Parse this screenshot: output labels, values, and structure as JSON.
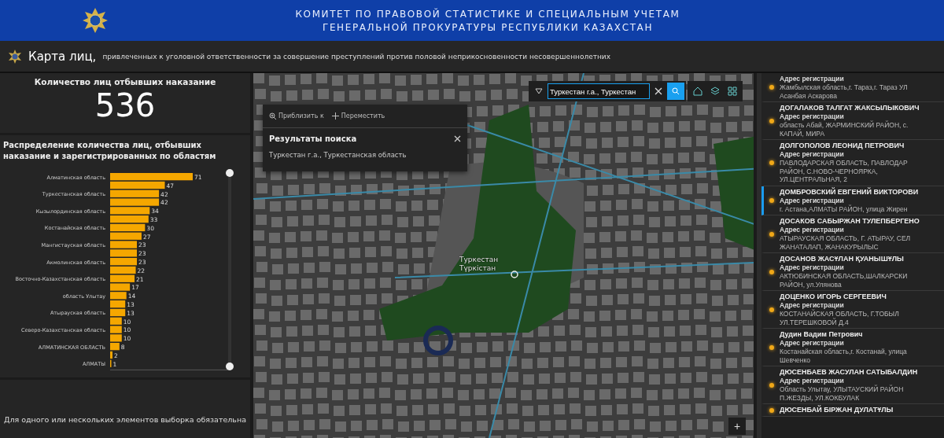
{
  "header": {
    "title_lines": [
      "КОМИТЕТ ПО ПРАВОВОЙ СТАТИСТИКЕ И СПЕЦИАЛЬНЫМ УЧЕТАМ",
      "ГЕНЕРАЛЬНОЙ ПРОКУРАТУРЫ РЕСПУБЛИКИ КАЗАХСТАН"
    ]
  },
  "subtitle": {
    "title": "Карта лиц,",
    "description": "привлеченных к уголовной ответственности за совершение преступлений против половой неприкосновенности несовершеннолетних"
  },
  "kpi": {
    "label": "Количество лиц отбывших наказание",
    "value": "536"
  },
  "chart_panel": {
    "title": "Распределение количества лиц, отбывших наказание и зарегистрированных по областям",
    "chart_data": {
      "type": "bar",
      "orientation": "horizontal",
      "data_labels": true,
      "categories": [
        "Алматинская область",
        null,
        "Туркестанская область",
        null,
        "Кызылординская область",
        null,
        "Костанайская область",
        null,
        "Мангистауская область",
        null,
        "Акмолинская область",
        null,
        "Восточно-Казахстанская область",
        null,
        "область Улытау",
        null,
        "Атырауская область",
        null,
        "Северо-Казахстанская область",
        null,
        "АЛМАТИНСКАЯ ОБЛАСТЬ",
        null,
        "АЛМАТЫ"
      ],
      "series": [
        {
          "color": "#f5a700",
          "values": [
            71,
            47,
            42,
            42,
            34,
            33,
            30,
            27,
            23,
            23,
            23,
            22,
            21,
            17,
            14,
            13,
            13,
            10,
            10,
            10,
            8,
            2,
            1
          ]
        }
      ]
    }
  },
  "notice": {
    "text": "Для одного или нескольких элементов выборка обязательна"
  },
  "map": {
    "search_value": "Туркестан г.а., Туркестан",
    "popup": {
      "actions": [
        "Приблизить к",
        "Переместить"
      ],
      "title": "Результаты поиска",
      "result": "Туркестан г.а., Туркестанская область"
    },
    "labels": [
      "Туркестан",
      "Түркістан"
    ],
    "zoom_in": "+"
  },
  "people": [
    {
      "address_label": "Адрес регистрации",
      "address_lines": [
        "Жамбылская область,г. Тараз,г. Тараз УЛ",
        "Асанбая Аскарова"
      ],
      "selected": false
    },
    {
      "name": "ДОГАЛАКОВ ТАЛГАТ ЖАКСЫЛЫКОВИЧ",
      "address_label": "Адрес регистрации",
      "address_lines": [
        "область Абай, ЖАРМИНСКИЙ РАЙОН, с.",
        "КАПАЙ, МИРА"
      ],
      "selected": false
    },
    {
      "name": "ДОЛГОПОЛОВ ЛЕОНИД ПЕТРОВИЧ",
      "address_label": "Адрес регистрации",
      "address_lines": [
        "ПАВЛОДАРСКАЯ ОБЛАСТЬ, ПАВЛОДАР",
        "РАЙОН, С.НОВО-ЧЕРНОЯРКА,",
        "УЛ.ЦЕНТРАЛЬНАЯ, 2"
      ],
      "selected": false
    },
    {
      "name": "ДОМБРОВСКИЙ ЕВГЕНИЙ ВИКТОРОВИ",
      "address_label": "Адрес регистрации",
      "address_lines": [
        "г. Астана,АЛМАТЫ РАЙОН, улица Жирен"
      ],
      "selected": true
    },
    {
      "name": "ДОСАКОВ САБЫРЖАН ТУЛЕПБЕРГЕНО",
      "address_label": "Адрес регистрации",
      "address_lines": [
        "АТЫРАУСКАЯ ОБЛАСТЬ, Г. АТЫРАУ, СЕЛ",
        "ЖАНАТАЛАП, ЖАНАКУРЫЛЫС"
      ],
      "selected": false
    },
    {
      "name": "ДОСАНОВ ЖАСҰЛАН ҚУАНЫШҰЛЫ",
      "address_label": "Адрес регистрации",
      "address_lines": [
        "АКТЮБИНСКАЯ ОБЛАСТЬ,ШАЛКАРСКИ",
        "РАЙОН, ул.Улянова"
      ],
      "selected": false
    },
    {
      "name": "ДОЦЕНКО ИГОРЬ СЕРГЕЕВИЧ",
      "address_label": "Адрес регистрации",
      "address_lines": [
        "КОСТАНАЙСКАЯ ОБЛАСТЬ, Г.ТОБЫЛ",
        "УЛ.ТЕРЕШКОВОЙ Д.4"
      ],
      "selected": false
    },
    {
      "name": "Дудин Вадим Петрович",
      "address_label": "Адрес регистрации",
      "address_lines": [
        "Костанайская область,г. Костанай, улица",
        "Шевченко"
      ],
      "selected": false
    },
    {
      "name": "ДЮСЕНБАЕВ ЖАСУЛАН САТЫБАЛДИН",
      "address_label": "Адрес регистрации",
      "address_lines": [
        "Область Улытау, УЛЫТАУСКИЙ РАЙОН",
        "П.ЖЕЗДЫ, УЛ.КОКБУЛАК"
      ],
      "selected": false
    },
    {
      "name": "ДЮСЕНБАЙ БІРЖАН ДУЛАТҰЛЫ",
      "selected": false
    }
  ]
}
